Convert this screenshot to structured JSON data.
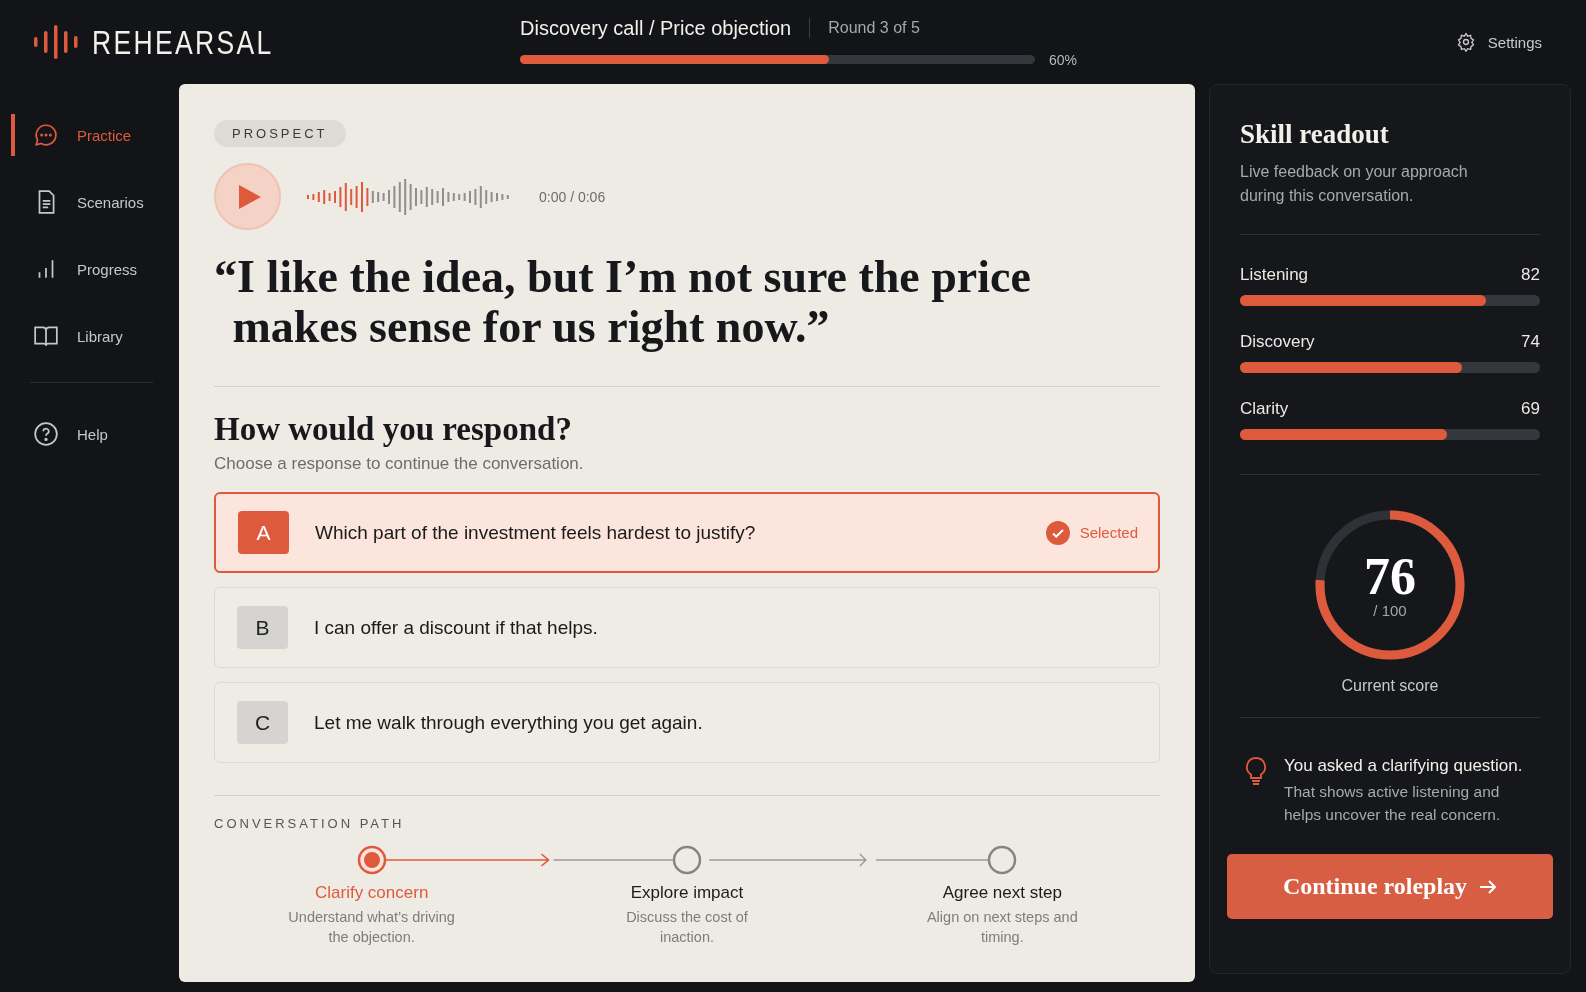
{
  "brand": {
    "name": "REHEARSAL"
  },
  "header": {
    "title": "Discovery call / Price objection",
    "round": "Round 3 of 5",
    "progress": {
      "level": 0.6,
      "reading": "60%"
    },
    "settings": "Settings"
  },
  "nav": [
    {
      "label": "Practice",
      "selected": true
    },
    {
      "label": "Scenarios",
      "selected": false
    },
    {
      "label": "Progress",
      "selected": false
    },
    {
      "label": "Library",
      "selected": false
    }
  ],
  "help": {
    "label": "Help"
  },
  "prompt": {
    "speaker": "PROSPECT",
    "time": "0:00 / 0:06",
    "quote": "“I like the idea, but I’m not sure the price makes sense for us right now.”"
  },
  "question": {
    "title": "How would you respond?",
    "subtitle": "Choose a response to continue the conversation."
  },
  "options": [
    {
      "letter": "A",
      "text": "Which part of the investment feels hardest to justify?",
      "selected": true,
      "status": "Selected"
    },
    {
      "letter": "B",
      "text": "I can offer a discount if that helps.",
      "selected": false
    },
    {
      "letter": "C",
      "text": "Let me walk through everything you get again.",
      "selected": false
    }
  ],
  "path": {
    "title": "CONVERSATION PATH",
    "steps": [
      {
        "label": "Clarify concern",
        "description": "Understand what’s driving the objection.",
        "selected": true
      },
      {
        "label": "Explore impact",
        "description": "Discuss the cost of inaction.",
        "selected": false
      },
      {
        "label": "Agree next step",
        "description": "Align on next steps and timing.",
        "selected": false
      }
    ]
  },
  "readout": {
    "title": "Skill readout",
    "subtitle": "Live feedback on your approach during this conversation.",
    "skills": [
      {
        "name": "Listening",
        "value": "82",
        "level": 0.82
      },
      {
        "name": "Discovery",
        "value": "74",
        "level": 0.74
      },
      {
        "name": "Clarity",
        "value": "69",
        "level": 0.69
      }
    ],
    "score": {
      "value": "76",
      "max": "/ 100",
      "label": "Current score",
      "level": 0.76
    },
    "feedback": {
      "title": "You asked a clarifying question.",
      "body": "That shows active listening and helps uncover the real concern."
    },
    "button": "Continue roleplay"
  }
}
